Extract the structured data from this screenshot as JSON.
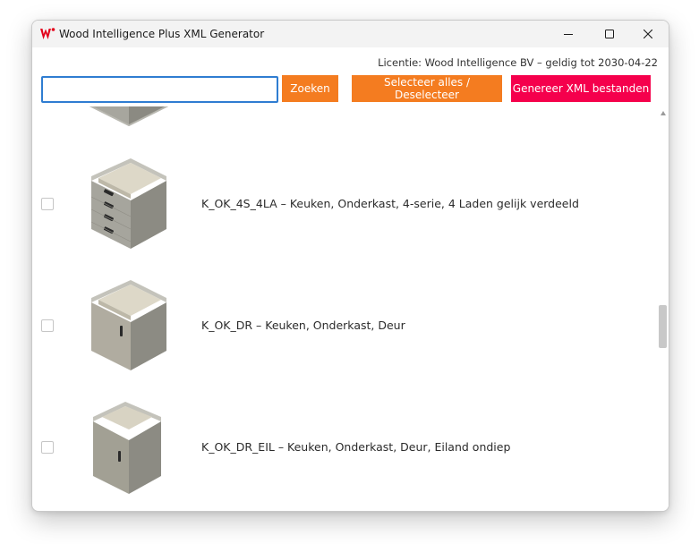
{
  "window": {
    "title": "Wood Intelligence Plus XML Generator"
  },
  "license": "Licentie: Wood Intelligence BV – geldig tot 2030-04-22",
  "search": {
    "value": "",
    "placeholder": ""
  },
  "buttons": {
    "search_label": "Zoeken",
    "select_all_label": "Selecteer alles / Deselecteer",
    "generate_label": "Genereer XML bestanden"
  },
  "colors": {
    "accent_orange": "#f47c20",
    "accent_red": "#f5004c",
    "focus_blue": "#2f7dd1"
  },
  "items": [
    {
      "label": "K_OK_4S_4LA – Keuken, Onderkast, 4-serie, 4 Laden gelijk verdeeld",
      "checked": false,
      "icon": "drawer-cabinet-icon"
    },
    {
      "label": "K_OK_DR – Keuken, Onderkast, Deur",
      "checked": false,
      "icon": "door-cabinet-icon"
    },
    {
      "label": "K_OK_DR_EIL – Keuken, Onderkast, Deur, Eiland ondiep",
      "checked": false,
      "icon": "island-cabinet-icon"
    }
  ]
}
